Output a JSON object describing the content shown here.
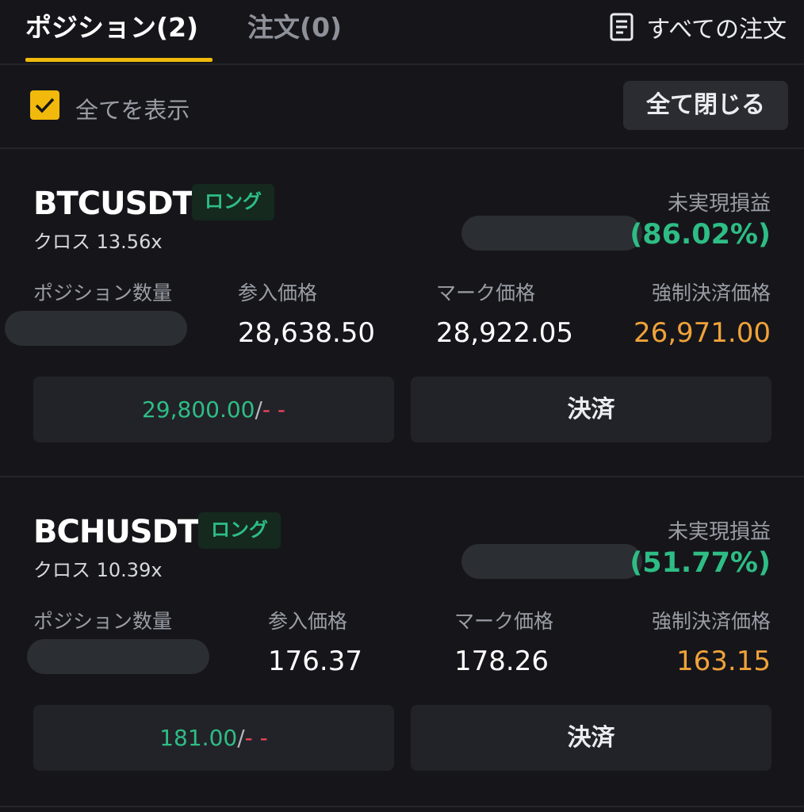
{
  "tabs": [
    {
      "label": "ポジション(2)",
      "active": true
    },
    {
      "label": "注文(0)",
      "active": false
    }
  ],
  "all_orders_label": "すべての注文",
  "filter": {
    "show_all_label": "全てを表示",
    "show_all_checked": true,
    "close_all_label": "全て閉じる"
  },
  "colors": {
    "accent": "#f0b90b",
    "profit": "#2ebd85",
    "loss": "#f6465d",
    "liquidation": "#f0a23a",
    "background": "#16161a"
  },
  "positions": [
    {
      "symbol": "BTCUSDT",
      "side": "ロング",
      "margin_mode": "クロス 13.56x",
      "pnl_label": "未実現損益",
      "pnl_percent": "(86.02%)",
      "qty_label": "ポジション数量",
      "entry_label": "参入価格",
      "entry_price": "28,638.50",
      "mark_label": "マーク価格",
      "mark_price": "28,922.05",
      "liq_label": "強制決済価格",
      "liq_price": "26,971.00",
      "tp": "29,800.00",
      "tp_sep": "/",
      "sl": "- -",
      "close_label": "決済"
    },
    {
      "symbol": "BCHUSDT",
      "side": "ロング",
      "margin_mode": "クロス 10.39x",
      "pnl_label": "未実現損益",
      "pnl_percent": "(51.77%)",
      "qty_label": "ポジション数量",
      "entry_label": "参入価格",
      "entry_price": "176.37",
      "mark_label": "マーク価格",
      "mark_price": "178.26",
      "liq_label": "強制決済価格",
      "liq_price": "163.15",
      "tp": "181.00",
      "tp_sep": "/",
      "sl": "- -",
      "close_label": "決済"
    }
  ],
  "icons": {
    "all_orders": "document-list-icon",
    "checkbox": "checkmark-icon"
  }
}
